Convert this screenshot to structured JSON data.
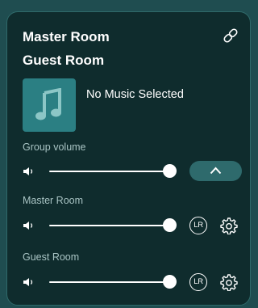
{
  "group": {
    "rooms": [
      "Master Room",
      "Guest Room"
    ],
    "now_playing": "No Music Selected",
    "volume_label": "Group volume",
    "volume": 0.98
  },
  "speakers": [
    {
      "name": "Master Room",
      "channel_label": "LR",
      "volume": 0.98
    },
    {
      "name": "Guest Room",
      "channel_label": "LR",
      "volume": 0.98
    }
  ],
  "icons": {
    "link": "link-icon",
    "album": "music-note-icon",
    "speaker": "speaker-icon",
    "expand": "chevron-up-icon",
    "settings": "gear-icon"
  },
  "colors": {
    "page_background": "#1f4d50",
    "panel_background": "#0f2c2d",
    "panel_border": "#2f6a6a",
    "album_art": "#2b7f83",
    "expand_button": "#2e6a6c",
    "label_text": "#a9c4c4",
    "foreground": "#ffffff"
  }
}
